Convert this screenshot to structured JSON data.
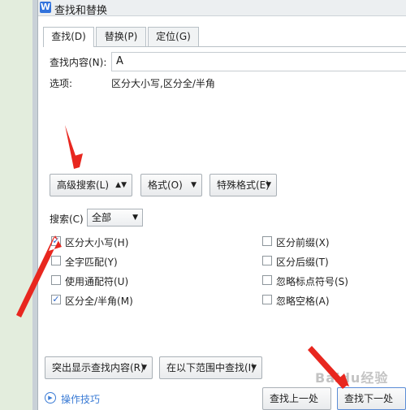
{
  "dialog": {
    "title": "查找和替换",
    "app_icon_letter": "W"
  },
  "tabs": [
    {
      "label": "查找(D)",
      "active": true
    },
    {
      "label": "替换(P)",
      "active": false
    },
    {
      "label": "定位(G)",
      "active": false
    }
  ],
  "find": {
    "label": "查找内容(N):",
    "value": "A",
    "options_label": "选项:",
    "options_value": "区分大小写,区分全/半角"
  },
  "buttons": {
    "advanced_search": "高级搜索(L)",
    "format": "格式(O)",
    "special_format": "特殊格式(E)",
    "highlight": "突出显示查找内容(R)",
    "find_in": "在以下范围中查找(I)",
    "find_prev": "查找上一处(B)",
    "find_next": "查找下一处(F)"
  },
  "search": {
    "label": "搜索(C)",
    "selected": "全部"
  },
  "options_left": [
    {
      "label": "区分大小写(H)",
      "checked": true
    },
    {
      "label": "全字匹配(Y)",
      "checked": false
    },
    {
      "label": "使用通配符(U)",
      "checked": false
    },
    {
      "label": "区分全/半角(M)",
      "checked": true
    }
  ],
  "options_right": [
    {
      "label": "区分前缀(X)",
      "checked": false
    },
    {
      "label": "区分后缀(T)",
      "checked": false
    },
    {
      "label": "忽略标点符号(S)",
      "checked": false
    },
    {
      "label": "忽略空格(A)",
      "checked": false
    }
  ],
  "help": {
    "label": "操作技巧"
  },
  "watermark": "Baidu经验",
  "colors": {
    "annotation_arrow": "#e8271f",
    "link": "#3a7bd5",
    "checkbox_tick": "#2a64c8"
  }
}
